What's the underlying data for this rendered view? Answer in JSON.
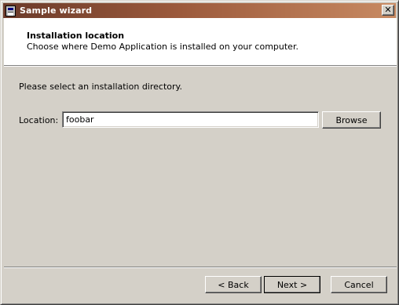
{
  "window": {
    "title": "Sample wizard",
    "icon": "app-icon",
    "close_label": "✕"
  },
  "header": {
    "title": "Installation location",
    "subtitle": "Choose where Demo Application is installed on your computer."
  },
  "main": {
    "instruction": "Please select an installation directory.",
    "location_label": "Location:",
    "location_value": "foobar",
    "browse_label": "Browse"
  },
  "footer": {
    "back_label": "< Back",
    "next_label": "Next >",
    "cancel_label": "Cancel"
  },
  "colors": {
    "titlebar_start": "#6b3a2a",
    "titlebar_end": "#c88a62",
    "face": "#d4d0c8"
  }
}
